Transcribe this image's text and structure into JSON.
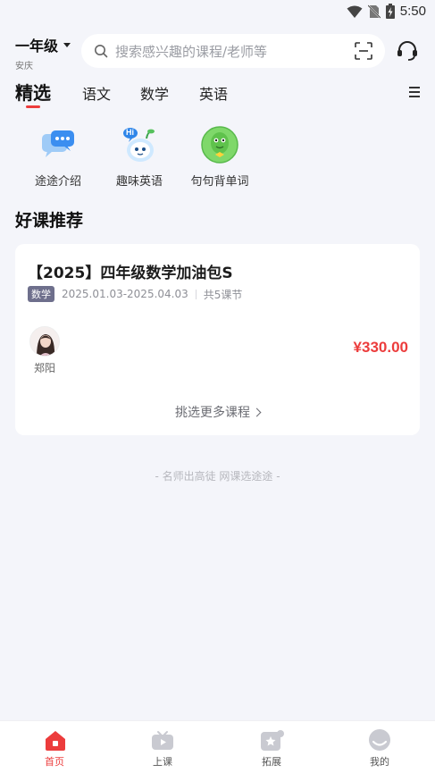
{
  "status_bar": {
    "time": "5:50"
  },
  "header": {
    "grade": "一年级",
    "location": "安庆",
    "search_placeholder": "搜索感兴趣的课程/老师等"
  },
  "tabs": [
    {
      "label": "精选",
      "active": true
    },
    {
      "label": "语文",
      "active": false
    },
    {
      "label": "数学",
      "active": false
    },
    {
      "label": "英语",
      "active": false
    }
  ],
  "quick_entries": [
    {
      "label": "途途介绍",
      "icon": "chat-bubbles-icon"
    },
    {
      "label": "趣味英语",
      "icon": "hi-mascot-icon"
    },
    {
      "label": "句句背单词",
      "icon": "green-mascot-icon"
    }
  ],
  "section": {
    "title": "好课推荐"
  },
  "course": {
    "title": "【2025】四年级数学加油包S",
    "subject": "数学",
    "date_range": "2025.01.03-2025.04.03",
    "lessons": "共5课节",
    "teacher": "郑阳",
    "price": "¥330.00",
    "more_label": "挑选更多课程"
  },
  "slogan": "- 名师出高徒 网课选途途 -",
  "bottom_nav": [
    {
      "label": "首页",
      "icon": "home-icon",
      "active": true
    },
    {
      "label": "上课",
      "icon": "play-tv-icon",
      "active": false
    },
    {
      "label": "拓展",
      "icon": "star-box-icon",
      "active": false
    },
    {
      "label": "我的",
      "icon": "profile-icon",
      "active": false
    }
  ],
  "colors": {
    "accent": "#ec3c3c",
    "background": "#f4f5fa",
    "tag": "#6e6f8c"
  }
}
